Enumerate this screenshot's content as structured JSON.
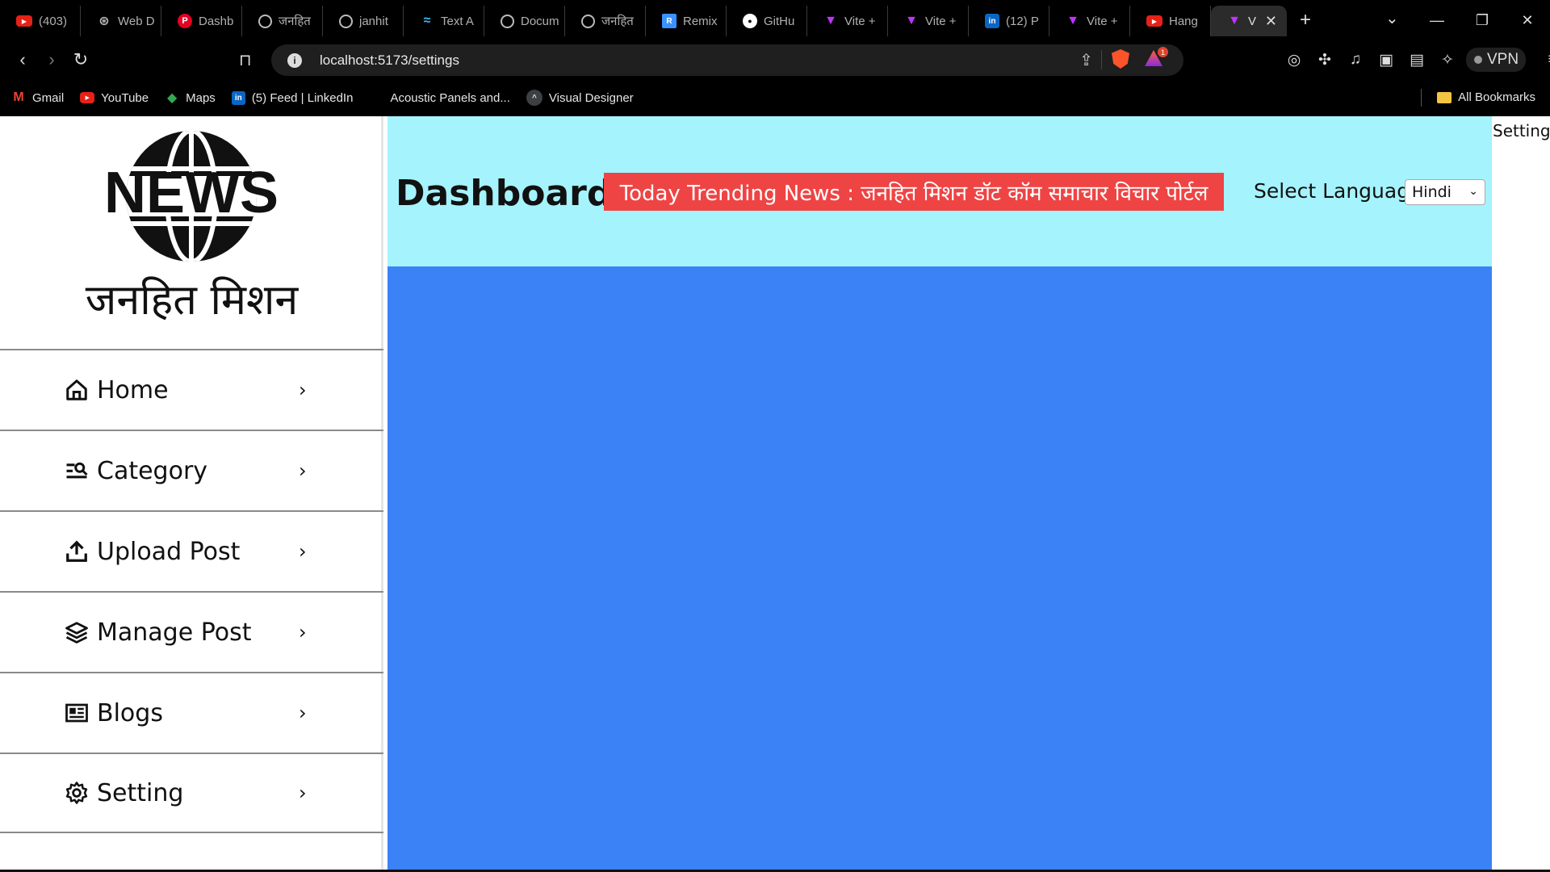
{
  "browser": {
    "tabs": [
      {
        "title": "(403)",
        "icon": "youtube-icon"
      },
      {
        "title": "Web D",
        "icon": "web-icon"
      },
      {
        "title": "Dashb",
        "icon": "pinterest-icon"
      },
      {
        "title": "जनहित",
        "icon": "globe-icon"
      },
      {
        "title": "janhit",
        "icon": "globe-icon"
      },
      {
        "title": "Text A",
        "icon": "tailwind-icon"
      },
      {
        "title": "Docum",
        "icon": "globe-icon"
      },
      {
        "title": "जनहित",
        "icon": "globe-icon"
      },
      {
        "title": "Remix",
        "icon": "remix-icon"
      },
      {
        "title": "GitHu",
        "icon": "github-icon"
      },
      {
        "title": "Vite +",
        "icon": "vite-icon"
      },
      {
        "title": "Vite +",
        "icon": "vite-icon"
      },
      {
        "title": "(12) P",
        "icon": "linkedin-icon"
      },
      {
        "title": "Vite +",
        "icon": "vite-icon"
      },
      {
        "title": "Hang",
        "icon": "youtube-icon"
      }
    ],
    "active_tab": {
      "title": "V",
      "icon": "vite-icon"
    },
    "url": "localhost:5173/settings",
    "vpn_label": "VPN",
    "notification_count": "1",
    "bookmarks": [
      {
        "label": "Gmail",
        "icon": "gmail-icon"
      },
      {
        "label": "YouTube",
        "icon": "youtube-icon"
      },
      {
        "label": "Maps",
        "icon": "maps-icon"
      },
      {
        "label": "(5) Feed | LinkedIn",
        "icon": "linkedin-icon"
      },
      {
        "label": "Acoustic Panels and...",
        "icon": "none"
      },
      {
        "label": "Visual Designer",
        "icon": "visual-designer-icon"
      }
    ],
    "all_bookmarks": "All Bookmarks"
  },
  "sidebar": {
    "logo_word": "NEWS",
    "logo_subtitle": "जनहित मिशन",
    "items": [
      {
        "label": "Home",
        "icon": "home-icon"
      },
      {
        "label": "Category",
        "icon": "category-icon"
      },
      {
        "label": "Upload Post",
        "icon": "upload-icon"
      },
      {
        "label": "Manage Post",
        "icon": "layers-icon"
      },
      {
        "label": "Blogs",
        "icon": "newspaper-icon"
      },
      {
        "label": "Setting",
        "icon": "gear-icon"
      }
    ]
  },
  "header": {
    "title": "Dashboard",
    "trending": "Today Trending News : जनहित मिशन डॉट कॉम समाचार विचार पोर्टल",
    "language_label": "Select Language:",
    "language_value": "Hindi"
  },
  "settings_text": "Settings",
  "colors": {
    "header_bg": "#a5f3fc",
    "content_bg": "#3b82f6",
    "trending_bg": "#ef4444"
  }
}
